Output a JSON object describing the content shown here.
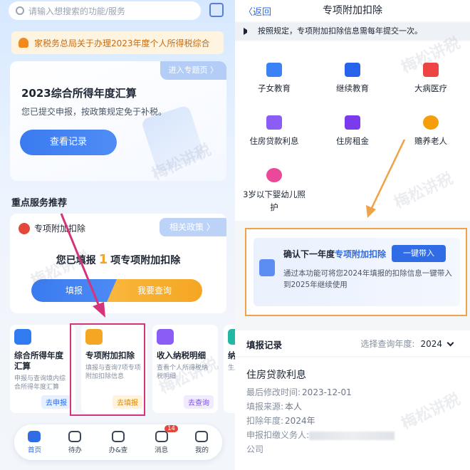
{
  "left": {
    "search": {
      "placeholder": "请输入想搜索的功能/服务"
    },
    "notice": "家税务总局关于办理2023年度个人所得税综合",
    "annual": {
      "topic_label": "进入专题页 〉",
      "title": "2023综合所得年度汇算",
      "subtitle": "您已提交申报，按政策规定免于补税。",
      "view_button": "查看记录"
    },
    "section_title": "重点服务推荐",
    "special": {
      "header": "专项附加扣除",
      "policy_label": "相关政策 〉",
      "filled_prefix": "您已填报",
      "filled_count": "1",
      "filled_suffix": "项专项附加扣除",
      "fill_button": "填报",
      "query_button": "我要查询"
    },
    "cards": [
      {
        "title": "综合所得年度汇算",
        "desc": "申报与查询境内综合所得年度汇算",
        "action": "去申报",
        "color": "#2f7bef",
        "action_bg": "#e7f0ff",
        "action_color": "#2f6ce5"
      },
      {
        "title": "专项附加扣除",
        "desc": "填报与查询7项专项附加扣除信息",
        "action": "去填报",
        "color": "#f5a623",
        "action_bg": "#fff3dc",
        "action_color": "#d98a12"
      },
      {
        "title": "收入纳税明细",
        "desc": "查看个人所得税纳税明细",
        "action": "去查询",
        "color": "#8b5cf6",
        "action_bg": "#f1ebff",
        "action_color": "#7c4ee6"
      },
      {
        "title": "纳税记",
        "desc": "生成或",
        "action": "",
        "color": "#22b8a4",
        "action_bg": "#ffffff",
        "action_color": "#22b8a4"
      }
    ],
    "tabs": [
      {
        "label": "首页",
        "active": true,
        "badge": ""
      },
      {
        "label": "待办",
        "active": false,
        "badge": ""
      },
      {
        "label": "办&查",
        "active": false,
        "badge": ""
      },
      {
        "label": "消息",
        "active": false,
        "badge": "14"
      },
      {
        "label": "我的",
        "active": false,
        "badge": ""
      }
    ]
  },
  "right": {
    "back_label": "返回",
    "title": "专项附加扣除",
    "tip": "按照规定，专项附加扣除信息需每年提交一次。",
    "items": [
      {
        "label": "子女教育",
        "color": "#3b82f6"
      },
      {
        "label": "继续教育",
        "color": "#2563eb"
      },
      {
        "label": "大病医疗",
        "color": "#ef4444"
      },
      {
        "label": "住房贷款利息",
        "color": "#8b5cf6"
      },
      {
        "label": "住房租金",
        "color": "#7c3aed"
      },
      {
        "label": "赡养老人",
        "color": "#f59e0b"
      },
      {
        "label": "3岁以下婴幼儿照护",
        "color": "#ec4899"
      }
    ],
    "confirm": {
      "title_prefix": "确认下一年度",
      "title_highlight": "专项附加扣除",
      "button": "一键带入",
      "desc": "通过本功能可将您2024年填报的扣除信息一键带入到2025年继续使用"
    },
    "records": {
      "title": "填报记录",
      "year_label": "选择查询年度:",
      "year_value": "2024",
      "record_title": "住房贷款利息",
      "modified_label": "最后修改时间:",
      "modified_value": "2023-12-01",
      "source_label": "填报来源:",
      "source_value": "本人",
      "year_row_label": "扣除年度:",
      "year_row_value": "2024年",
      "agent_label": "申报扣缴义务人:",
      "agent_tail": "公司"
    }
  },
  "watermark": "梅松讲税"
}
